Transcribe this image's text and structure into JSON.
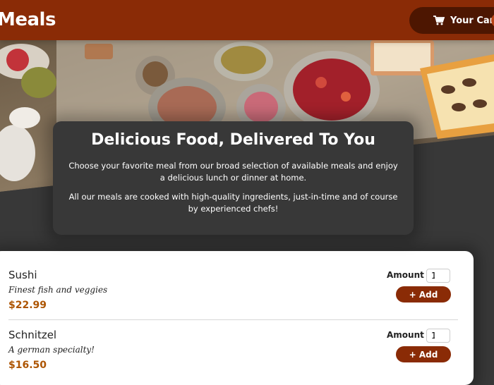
{
  "header": {
    "brand": "Meals",
    "cart_label": "Your Cart",
    "cart_icon": "cart-icon"
  },
  "hero": {
    "image": "food-buffet-table-photo"
  },
  "summary": {
    "title": "Delicious Food, Delivered To You",
    "paragraph1": "Choose your favorite meal from our broad selection of available meals and enjoy a delicious lunch or dinner at home.",
    "paragraph2": "All our meals are cooked with high-quality ingredients, just-in-time and of course by experienced chefs!"
  },
  "meals": [
    {
      "name": "Sushi",
      "description": "Finest fish and veggies",
      "price": "$22.99",
      "amount_label": "Amount",
      "amount_value": "1",
      "add_label": "+ Add"
    },
    {
      "name": "Schnitzel",
      "description": "A german specialty!",
      "price": "$16.50",
      "amount_label": "Amount",
      "amount_value": "1",
      "add_label": "+ Add"
    }
  ],
  "colors": {
    "header_bg": "#8a2b06",
    "cart_bg": "#4d1601",
    "page_bg": "#383838",
    "price": "#ad5502"
  }
}
